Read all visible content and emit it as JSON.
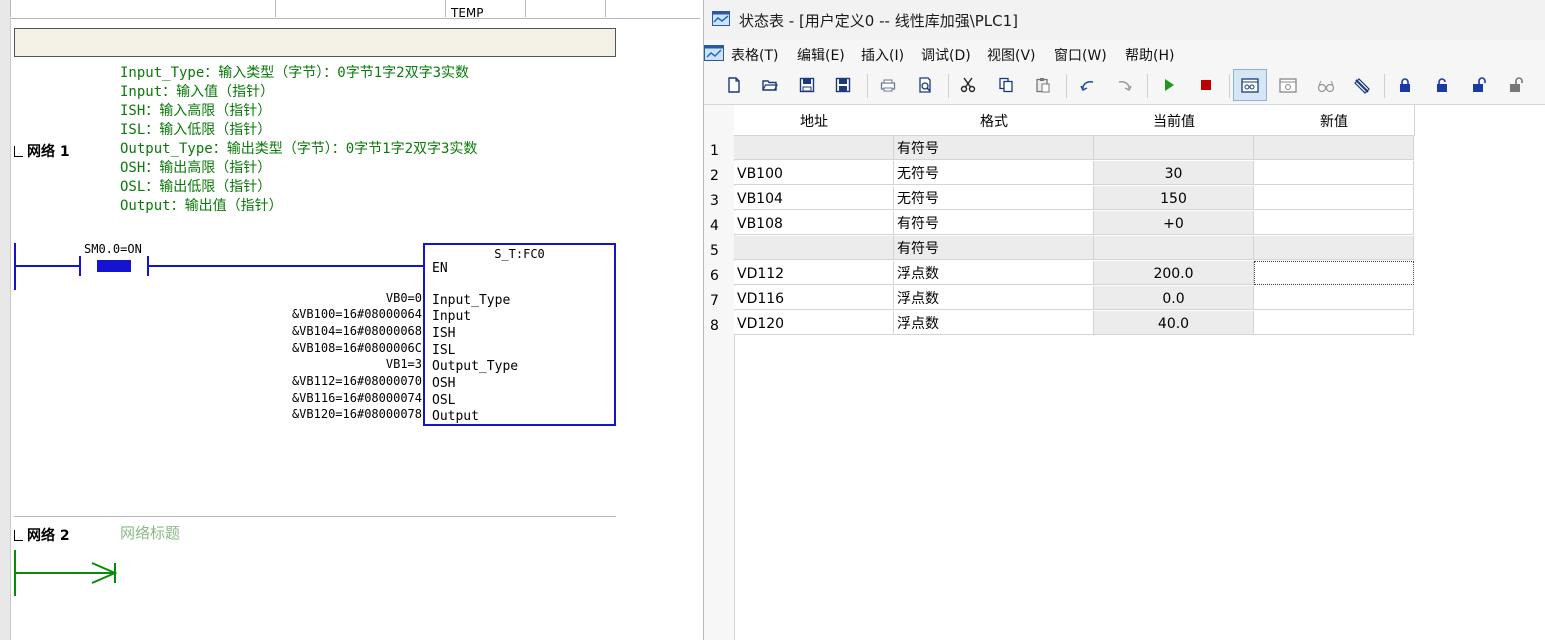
{
  "editor": {
    "var_table_header_cell": "TEMP",
    "network1": {
      "label": "网络 1",
      "comments": [
        "Input_Type：输入类型（字节）：0字节1字2双字3实数",
        "Input：输入值（指针）",
        "ISH：输入高限（指针）",
        "ISL：输入低限（指针）",
        "Output_Type：输出类型（字节）：0字节1字2双字3实数",
        "OSH：输出高限（指针）",
        "OSL：输出低限（指针）",
        "Output：输出值（指针）"
      ],
      "contact_label": "SM0.0=ON",
      "block_title": "S_T:FC0",
      "block_en": "EN",
      "pins": [
        {
          "name": "Input_Type",
          "param": "VB0=0"
        },
        {
          "name": "Input",
          "param": "&VB100=16#08000064"
        },
        {
          "name": "ISH",
          "param": "&VB104=16#08000068"
        },
        {
          "name": "ISL",
          "param": "&VB108=16#0800006C"
        },
        {
          "name": "Output_Type",
          "param": "VB1=3"
        },
        {
          "name": "OSH",
          "param": "&VB112=16#08000070"
        },
        {
          "name": "OSL",
          "param": "&VB116=16#08000074"
        },
        {
          "name": "Output",
          "param": "&VB120=16#08000078"
        }
      ]
    },
    "network2": {
      "label": "网络 2",
      "title": "网络标题"
    }
  },
  "status_window": {
    "title": "状态表 - [用户定义0 -- 线性库加强\\PLC1]",
    "menu": [
      "表格(T)",
      "编辑(E)",
      "插入(I)",
      "调试(D)",
      "视图(V)",
      "窗口(W)",
      "帮助(H)"
    ],
    "columns": [
      "地址",
      "格式",
      "当前值",
      "新值"
    ],
    "rows": [
      {
        "num": "1",
        "address": "",
        "format": "有符号",
        "current": "",
        "new": ""
      },
      {
        "num": "2",
        "address": "VB100",
        "format": "无符号",
        "current": "30",
        "new": ""
      },
      {
        "num": "3",
        "address": "VB104",
        "format": "无符号",
        "current": "150",
        "new": ""
      },
      {
        "num": "4",
        "address": "VB108",
        "format": "有符号",
        "current": "+0",
        "new": ""
      },
      {
        "num": "5",
        "address": "",
        "format": "有符号",
        "current": "",
        "new": ""
      },
      {
        "num": "6",
        "address": "VD112",
        "format": "浮点数",
        "current": "200.0",
        "new": ""
      },
      {
        "num": "7",
        "address": "VD116",
        "format": "浮点数",
        "current": "0.0",
        "new": ""
      },
      {
        "num": "8",
        "address": "VD120",
        "format": "浮点数",
        "current": "40.0",
        "new": ""
      }
    ],
    "colors": {
      "accent": "#1414d0",
      "comment": "#0a7a0a",
      "run": "#1a9a1a",
      "stop": "#c00000"
    }
  }
}
